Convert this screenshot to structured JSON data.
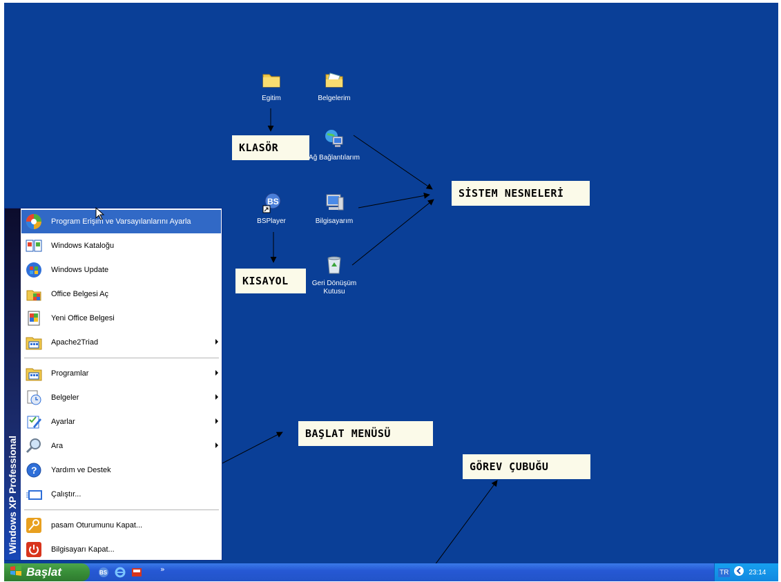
{
  "desktop": {
    "icons": [
      {
        "label": "Egitim",
        "icon": "folder-icon"
      },
      {
        "label": "Belgelerim",
        "icon": "my-documents-icon"
      },
      {
        "label": "Ağ Bağlantılarım",
        "icon": "network-connections-icon"
      },
      {
        "label": "BSPlayer",
        "icon": "bsplayer-shortcut-icon"
      },
      {
        "label": "Bilgisayarım",
        "icon": "my-computer-icon"
      },
      {
        "label": "Geri Dönüşüm Kutusu",
        "icon": "recycle-bin-icon"
      }
    ],
    "annotations": {
      "klasor": "KLASÖR",
      "kisayol": "KISAYOL",
      "sistem": "SİSTEM NESNELERİ",
      "baslat": "BAŞLAT MENÜSÜ",
      "gorev": "GÖREV ÇUBUĞU"
    }
  },
  "start_menu": {
    "banner": "Windows XP Professional",
    "items": [
      {
        "label": "Program Erişim ve Varsayılanlarını Ayarla",
        "icon": "set-program-access-icon",
        "highlighted": true
      },
      {
        "label": "Windows Kataloğu",
        "icon": "windows-catalog-icon"
      },
      {
        "label": "Windows Update",
        "icon": "windows-update-icon"
      },
      {
        "label": "Office Belgesi Aç",
        "icon": "office-open-icon"
      },
      {
        "label": "Yeni Office Belgesi",
        "icon": "office-new-icon"
      },
      {
        "label": "Apache2Triad",
        "icon": "program-group-icon",
        "submenu": true
      },
      {
        "label": "Programlar",
        "icon": "programs-icon",
        "submenu": true
      },
      {
        "label": "Belgeler",
        "icon": "documents-icon",
        "submenu": true
      },
      {
        "label": "Ayarlar",
        "icon": "settings-icon",
        "submenu": true
      },
      {
        "label": "Ara",
        "icon": "search-icon",
        "submenu": true
      },
      {
        "label": "Yardım ve Destek",
        "icon": "help-icon"
      },
      {
        "label": "Çalıştır...",
        "icon": "run-icon"
      },
      {
        "label": "pasam Oturumunu Kapat...",
        "icon": "log-off-icon"
      },
      {
        "label": "Bilgisayarı Kapat...",
        "icon": "shut-down-icon"
      }
    ]
  },
  "taskbar": {
    "start_label": "Başlat",
    "quick_launch": [
      "bsplayer-icon",
      "internet-explorer-icon",
      "media-icon"
    ],
    "chevron": "»",
    "language": "TR",
    "clock": "23:14"
  },
  "colors": {
    "desktop": "#0a3f97",
    "menu_highlight": "#3169c6",
    "taskbar": "#2658d4",
    "start_button": "#388e38"
  }
}
